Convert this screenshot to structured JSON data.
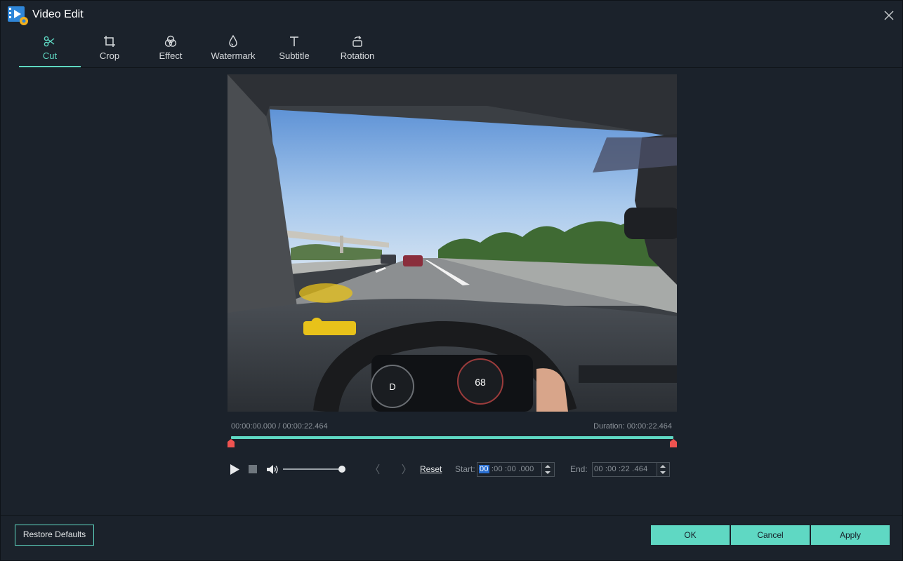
{
  "window": {
    "title": "Video Edit"
  },
  "tabs": [
    {
      "label": "Cut",
      "icon": "scissors-icon",
      "active": true
    },
    {
      "label": "Crop",
      "icon": "crop-icon",
      "active": false
    },
    {
      "label": "Effect",
      "icon": "effect-icon",
      "active": false
    },
    {
      "label": "Watermark",
      "icon": "watermark-icon",
      "active": false
    },
    {
      "label": "Subtitle",
      "icon": "subtitle-icon",
      "active": false
    },
    {
      "label": "Rotation",
      "icon": "rotation-icon",
      "active": false
    }
  ],
  "player": {
    "current_time": "00:00:00.000 / 00:00:22.464",
    "duration": "Duration: 00:00:22.464",
    "volume_level": 1.0,
    "trim_start_fraction": 0.0,
    "trim_end_fraction": 1.0
  },
  "cut": {
    "reset_label": "Reset",
    "start_label": "Start:",
    "start_selected": "00",
    "start_rest": " :00 :00 .000",
    "end_label": "End:",
    "end_value": "00 :00 :22 .464"
  },
  "buttons": {
    "restore_defaults": "Restore Defaults",
    "ok": "OK",
    "cancel": "Cancel",
    "apply": "Apply"
  },
  "colors": {
    "accent": "#5fd8c3",
    "background": "#1b222b",
    "selection": "#2a6fd1"
  }
}
